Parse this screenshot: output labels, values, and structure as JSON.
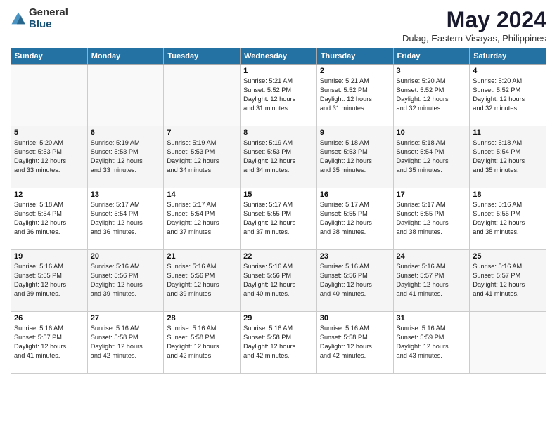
{
  "logo": {
    "general": "General",
    "blue": "Blue"
  },
  "title": "May 2024",
  "subtitle": "Dulag, Eastern Visayas, Philippines",
  "days_header": [
    "Sunday",
    "Monday",
    "Tuesday",
    "Wednesday",
    "Thursday",
    "Friday",
    "Saturday"
  ],
  "weeks": [
    [
      {
        "day": "",
        "info": ""
      },
      {
        "day": "",
        "info": ""
      },
      {
        "day": "",
        "info": ""
      },
      {
        "day": "1",
        "info": "Sunrise: 5:21 AM\nSunset: 5:52 PM\nDaylight: 12 hours\nand 31 minutes."
      },
      {
        "day": "2",
        "info": "Sunrise: 5:21 AM\nSunset: 5:52 PM\nDaylight: 12 hours\nand 31 minutes."
      },
      {
        "day": "3",
        "info": "Sunrise: 5:20 AM\nSunset: 5:52 PM\nDaylight: 12 hours\nand 32 minutes."
      },
      {
        "day": "4",
        "info": "Sunrise: 5:20 AM\nSunset: 5:52 PM\nDaylight: 12 hours\nand 32 minutes."
      }
    ],
    [
      {
        "day": "5",
        "info": "Sunrise: 5:20 AM\nSunset: 5:53 PM\nDaylight: 12 hours\nand 33 minutes."
      },
      {
        "day": "6",
        "info": "Sunrise: 5:19 AM\nSunset: 5:53 PM\nDaylight: 12 hours\nand 33 minutes."
      },
      {
        "day": "7",
        "info": "Sunrise: 5:19 AM\nSunset: 5:53 PM\nDaylight: 12 hours\nand 34 minutes."
      },
      {
        "day": "8",
        "info": "Sunrise: 5:19 AM\nSunset: 5:53 PM\nDaylight: 12 hours\nand 34 minutes."
      },
      {
        "day": "9",
        "info": "Sunrise: 5:18 AM\nSunset: 5:53 PM\nDaylight: 12 hours\nand 35 minutes."
      },
      {
        "day": "10",
        "info": "Sunrise: 5:18 AM\nSunset: 5:54 PM\nDaylight: 12 hours\nand 35 minutes."
      },
      {
        "day": "11",
        "info": "Sunrise: 5:18 AM\nSunset: 5:54 PM\nDaylight: 12 hours\nand 35 minutes."
      }
    ],
    [
      {
        "day": "12",
        "info": "Sunrise: 5:18 AM\nSunset: 5:54 PM\nDaylight: 12 hours\nand 36 minutes."
      },
      {
        "day": "13",
        "info": "Sunrise: 5:17 AM\nSunset: 5:54 PM\nDaylight: 12 hours\nand 36 minutes."
      },
      {
        "day": "14",
        "info": "Sunrise: 5:17 AM\nSunset: 5:54 PM\nDaylight: 12 hours\nand 37 minutes."
      },
      {
        "day": "15",
        "info": "Sunrise: 5:17 AM\nSunset: 5:55 PM\nDaylight: 12 hours\nand 37 minutes."
      },
      {
        "day": "16",
        "info": "Sunrise: 5:17 AM\nSunset: 5:55 PM\nDaylight: 12 hours\nand 38 minutes."
      },
      {
        "day": "17",
        "info": "Sunrise: 5:17 AM\nSunset: 5:55 PM\nDaylight: 12 hours\nand 38 minutes."
      },
      {
        "day": "18",
        "info": "Sunrise: 5:16 AM\nSunset: 5:55 PM\nDaylight: 12 hours\nand 38 minutes."
      }
    ],
    [
      {
        "day": "19",
        "info": "Sunrise: 5:16 AM\nSunset: 5:55 PM\nDaylight: 12 hours\nand 39 minutes."
      },
      {
        "day": "20",
        "info": "Sunrise: 5:16 AM\nSunset: 5:56 PM\nDaylight: 12 hours\nand 39 minutes."
      },
      {
        "day": "21",
        "info": "Sunrise: 5:16 AM\nSunset: 5:56 PM\nDaylight: 12 hours\nand 39 minutes."
      },
      {
        "day": "22",
        "info": "Sunrise: 5:16 AM\nSunset: 5:56 PM\nDaylight: 12 hours\nand 40 minutes."
      },
      {
        "day": "23",
        "info": "Sunrise: 5:16 AM\nSunset: 5:56 PM\nDaylight: 12 hours\nand 40 minutes."
      },
      {
        "day": "24",
        "info": "Sunrise: 5:16 AM\nSunset: 5:57 PM\nDaylight: 12 hours\nand 41 minutes."
      },
      {
        "day": "25",
        "info": "Sunrise: 5:16 AM\nSunset: 5:57 PM\nDaylight: 12 hours\nand 41 minutes."
      }
    ],
    [
      {
        "day": "26",
        "info": "Sunrise: 5:16 AM\nSunset: 5:57 PM\nDaylight: 12 hours\nand 41 minutes."
      },
      {
        "day": "27",
        "info": "Sunrise: 5:16 AM\nSunset: 5:58 PM\nDaylight: 12 hours\nand 42 minutes."
      },
      {
        "day": "28",
        "info": "Sunrise: 5:16 AM\nSunset: 5:58 PM\nDaylight: 12 hours\nand 42 minutes."
      },
      {
        "day": "29",
        "info": "Sunrise: 5:16 AM\nSunset: 5:58 PM\nDaylight: 12 hours\nand 42 minutes."
      },
      {
        "day": "30",
        "info": "Sunrise: 5:16 AM\nSunset: 5:58 PM\nDaylight: 12 hours\nand 42 minutes."
      },
      {
        "day": "31",
        "info": "Sunrise: 5:16 AM\nSunset: 5:59 PM\nDaylight: 12 hours\nand 43 minutes."
      },
      {
        "day": "",
        "info": ""
      }
    ]
  ]
}
